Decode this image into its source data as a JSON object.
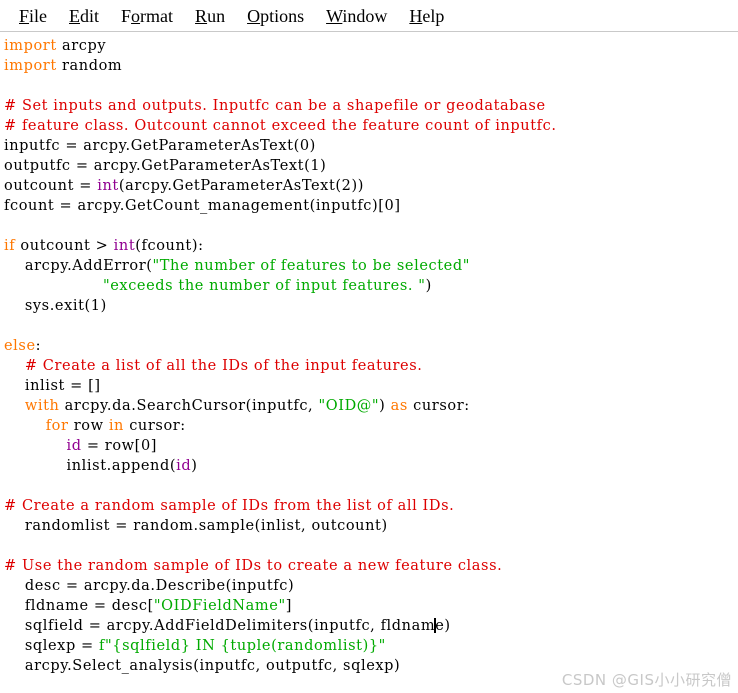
{
  "window": {
    "app": "Python IDLE Editor"
  },
  "menubar": {
    "items": [
      {
        "name": "file",
        "label": "File",
        "accel": "F",
        "rest": "ile"
      },
      {
        "name": "edit",
        "label": "Edit",
        "accel": "E",
        "rest": "dit"
      },
      {
        "name": "format",
        "label": "Format",
        "pre": "F",
        "accel": "o",
        "rest": "rmat"
      },
      {
        "name": "run",
        "label": "Run",
        "accel": "R",
        "rest": "un"
      },
      {
        "name": "options",
        "label": "Options",
        "accel": "O",
        "rest": "ptions"
      },
      {
        "name": "window",
        "label": "Window",
        "accel": "W",
        "rest": "indow"
      },
      {
        "name": "help",
        "label": "Help",
        "accel": "H",
        "rest": "elp"
      }
    ]
  },
  "colors": {
    "keyword": "#ff7700",
    "comment": "#dd0000",
    "string": "#00aa00",
    "builtin": "#900090",
    "definition": "#0000ff",
    "normal": "#000000",
    "background": "#ffffff",
    "watermark": "#c8c8c8"
  },
  "editor": {
    "language": "python",
    "cursor": {
      "line": 28,
      "column": 54
    },
    "code_lines": [
      [
        [
          "kw",
          "import"
        ],
        [
          "n",
          " arcpy"
        ]
      ],
      [
        [
          "kw",
          "import"
        ],
        [
          "n",
          " random"
        ]
      ],
      [
        [
          "n",
          ""
        ]
      ],
      [
        [
          "cmt",
          "# Set inputs and outputs. Inputfc can be a shapefile or geodatabase"
        ]
      ],
      [
        [
          "cmt",
          "# feature class. Outcount cannot exceed the feature count of inputfc."
        ]
      ],
      [
        [
          "n",
          "inputfc = arcpy.GetParameterAsText(0)"
        ]
      ],
      [
        [
          "n",
          "outputfc = arcpy.GetParameterAsText(1)"
        ]
      ],
      [
        [
          "n",
          "outcount = "
        ],
        [
          "bi",
          "int"
        ],
        [
          "n",
          "(arcpy.GetParameterAsText(2))"
        ]
      ],
      [
        [
          "n",
          "fcount = arcpy.GetCount_management(inputfc)[0]"
        ]
      ],
      [
        [
          "n",
          ""
        ]
      ],
      [
        [
          "kw",
          "if"
        ],
        [
          "n",
          " outcount > "
        ],
        [
          "bi",
          "int"
        ],
        [
          "n",
          "(fcount):"
        ]
      ],
      [
        [
          "n",
          "    arcpy.AddError("
        ],
        [
          "str",
          "\"The number of features to be selected\""
        ]
      ],
      [
        [
          "n",
          "                   "
        ],
        [
          "str",
          "\"exceeds the number of input features. \""
        ],
        [
          "n",
          ")"
        ]
      ],
      [
        [
          "n",
          "    sys.exit(1)"
        ]
      ],
      [
        [
          "n",
          ""
        ]
      ],
      [
        [
          "kw",
          "else"
        ],
        [
          "n",
          ":"
        ]
      ],
      [
        [
          "n",
          "    "
        ],
        [
          "cmt",
          "# Create a list of all the IDs of the input features."
        ]
      ],
      [
        [
          "n",
          "    inlist = []"
        ]
      ],
      [
        [
          "n",
          "    "
        ],
        [
          "kw",
          "with"
        ],
        [
          "n",
          " arcpy.da.SearchCursor(inputfc, "
        ],
        [
          "str",
          "\"OID@\""
        ],
        [
          "n",
          ") "
        ],
        [
          "kw",
          "as"
        ],
        [
          "n",
          " cursor:"
        ]
      ],
      [
        [
          "n",
          "        "
        ],
        [
          "kw",
          "for"
        ],
        [
          "n",
          " row "
        ],
        [
          "kw",
          "in"
        ],
        [
          "n",
          " cursor:"
        ]
      ],
      [
        [
          "n",
          "            "
        ],
        [
          "bi",
          "id"
        ],
        [
          "n",
          " = row[0]"
        ]
      ],
      [
        [
          "n",
          "            inlist.append("
        ],
        [
          "bi",
          "id"
        ],
        [
          "n",
          ")"
        ]
      ],
      [
        [
          "n",
          ""
        ]
      ],
      [
        [
          "cmt",
          "# Create a random sample of IDs from the list of all IDs."
        ]
      ],
      [
        [
          "n",
          "    randomlist = random.sample(inlist, outcount)"
        ]
      ],
      [
        [
          "n",
          ""
        ]
      ],
      [
        [
          "cmt",
          "# Use the random sample of IDs to create a new feature class."
        ]
      ],
      [
        [
          "n",
          "    desc = arcpy.da.Describe(inputfc)"
        ]
      ],
      [
        [
          "n",
          "    fldname = desc["
        ],
        [
          "str",
          "\"OIDFieldName\""
        ],
        [
          "n",
          "]"
        ]
      ],
      [
        [
          "n",
          "    sqlfield = arcpy.AddFieldDelimiters(inputfc, fldnam"
        ],
        [
          "caret",
          ""
        ],
        [
          "n",
          "e)"
        ]
      ],
      [
        [
          "n",
          "    sqlexp = "
        ],
        [
          "str",
          "f\"{sqlfield} IN {tuple(randomlist)}\""
        ]
      ],
      [
        [
          "n",
          "    arcpy.Select_analysis(inputfc, outputfc, sqlexp)"
        ]
      ]
    ]
  },
  "watermark": {
    "text": "CSDN @GIS小小研究僧"
  }
}
